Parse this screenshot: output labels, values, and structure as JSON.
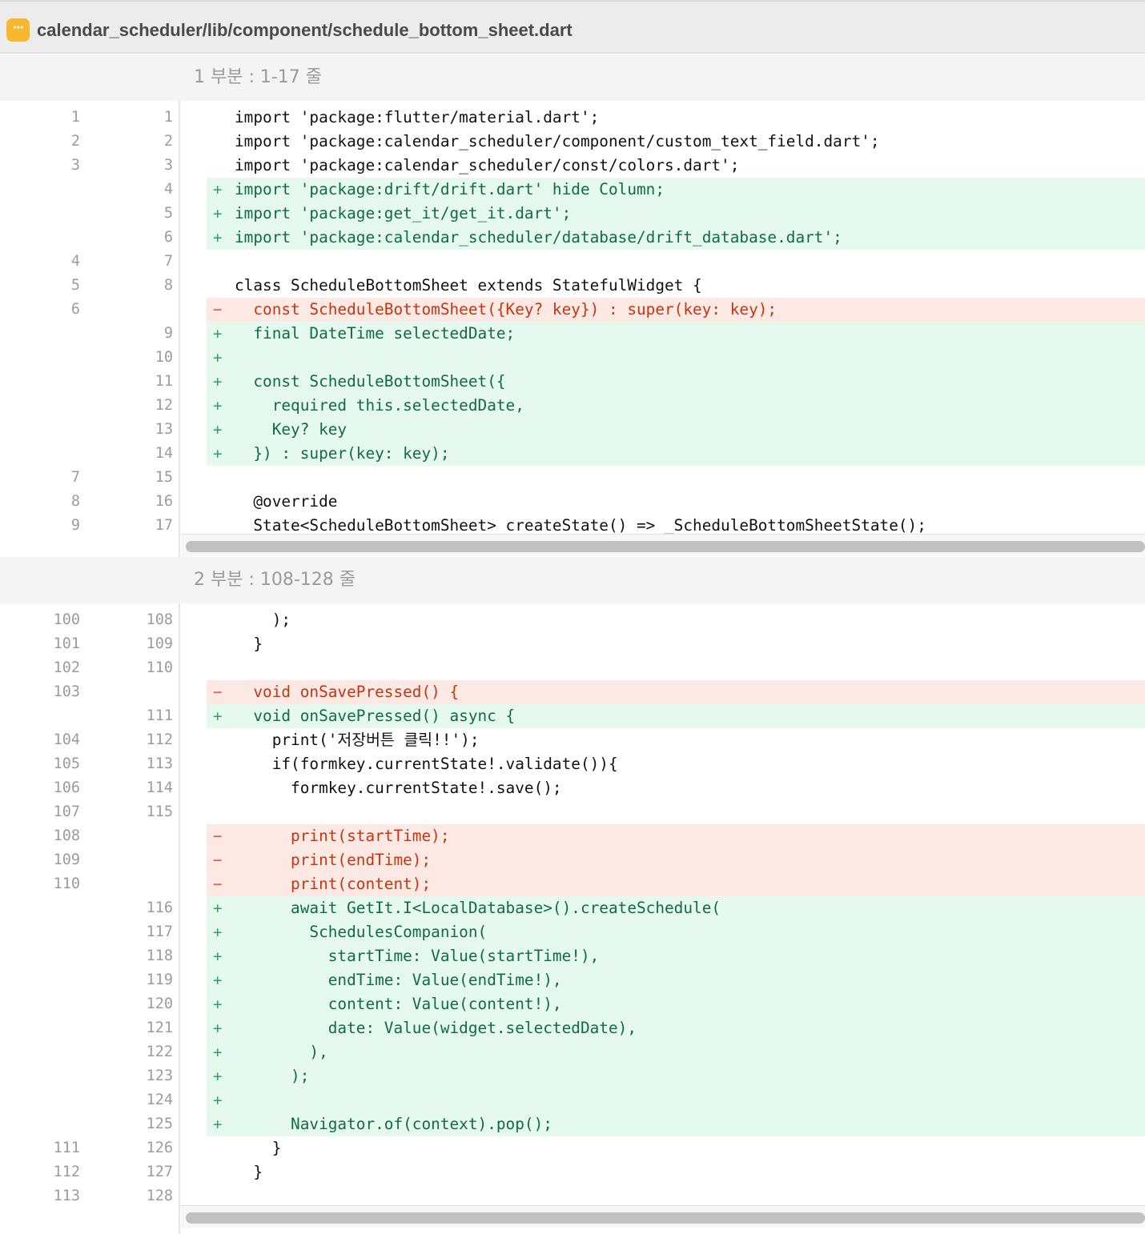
{
  "header": {
    "badge_glyph": "···",
    "file_path": "calendar_scheduler/lib/component/schedule_bottom_sheet.dart"
  },
  "hunks": [
    {
      "label": "1 부분 : 1-17 줄",
      "lines": [
        {
          "type": "ctx",
          "old": "1",
          "new": "1",
          "code": "import 'package:flutter/material.dart';"
        },
        {
          "type": "ctx",
          "old": "2",
          "new": "2",
          "code": "import 'package:calendar_scheduler/component/custom_text_field.dart';"
        },
        {
          "type": "ctx",
          "old": "3",
          "new": "3",
          "code": "import 'package:calendar_scheduler/const/colors.dart';"
        },
        {
          "type": "add",
          "old": "",
          "new": "4",
          "code": "import 'package:drift/drift.dart' hide Column;"
        },
        {
          "type": "add",
          "old": "",
          "new": "5",
          "code": "import 'package:get_it/get_it.dart';"
        },
        {
          "type": "add",
          "old": "",
          "new": "6",
          "code": "import 'package:calendar_scheduler/database/drift_database.dart';"
        },
        {
          "type": "ctx",
          "old": "4",
          "new": "7",
          "code": ""
        },
        {
          "type": "ctx",
          "old": "5",
          "new": "8",
          "code": "class ScheduleBottomSheet extends StatefulWidget {"
        },
        {
          "type": "del",
          "old": "6",
          "new": "",
          "code": "  const ScheduleBottomSheet({Key? key}) : super(key: key);"
        },
        {
          "type": "add",
          "old": "",
          "new": "9",
          "code": "  final DateTime selectedDate;"
        },
        {
          "type": "add",
          "old": "",
          "new": "10",
          "code": ""
        },
        {
          "type": "add",
          "old": "",
          "new": "11",
          "code": "  const ScheduleBottomSheet({"
        },
        {
          "type": "add",
          "old": "",
          "new": "12",
          "code": "    required this.selectedDate,"
        },
        {
          "type": "add",
          "old": "",
          "new": "13",
          "code": "    Key? key"
        },
        {
          "type": "add",
          "old": "",
          "new": "14",
          "code": "  }) : super(key: key);"
        },
        {
          "type": "ctx",
          "old": "7",
          "new": "15",
          "code": ""
        },
        {
          "type": "ctx",
          "old": "8",
          "new": "16",
          "code": "  @override"
        },
        {
          "type": "ctx",
          "old": "9",
          "new": "17",
          "code": "  State<ScheduleBottomSheet> createState() => _ScheduleBottomSheetState();"
        }
      ]
    },
    {
      "label": "2 부분 : 108-128 줄",
      "lines": [
        {
          "type": "ctx",
          "old": "100",
          "new": "108",
          "code": "    );"
        },
        {
          "type": "ctx",
          "old": "101",
          "new": "109",
          "code": "  }"
        },
        {
          "type": "ctx",
          "old": "102",
          "new": "110",
          "code": ""
        },
        {
          "type": "del",
          "old": "103",
          "new": "",
          "code": "  void onSavePressed() {"
        },
        {
          "type": "add",
          "old": "",
          "new": "111",
          "code": "  void onSavePressed() async {"
        },
        {
          "type": "ctx",
          "old": "104",
          "new": "112",
          "code": "    print('저장버튼 클릭!!');"
        },
        {
          "type": "ctx",
          "old": "105",
          "new": "113",
          "code": "    if(formkey.currentState!.validate()){"
        },
        {
          "type": "ctx",
          "old": "106",
          "new": "114",
          "code": "      formkey.currentState!.save();"
        },
        {
          "type": "ctx",
          "old": "107",
          "new": "115",
          "code": ""
        },
        {
          "type": "del",
          "old": "108",
          "new": "",
          "code": "      print(startTime);"
        },
        {
          "type": "del",
          "old": "109",
          "new": "",
          "code": "      print(endTime);"
        },
        {
          "type": "del",
          "old": "110",
          "new": "",
          "code": "      print(content);"
        },
        {
          "type": "add",
          "old": "",
          "new": "116",
          "code": "      await GetIt.I<LocalDatabase>().createSchedule("
        },
        {
          "type": "add",
          "old": "",
          "new": "117",
          "code": "        SchedulesCompanion("
        },
        {
          "type": "add",
          "old": "",
          "new": "118",
          "code": "          startTime: Value(startTime!),"
        },
        {
          "type": "add",
          "old": "",
          "new": "119",
          "code": "          endTime: Value(endTime!),"
        },
        {
          "type": "add",
          "old": "",
          "new": "120",
          "code": "          content: Value(content!),"
        },
        {
          "type": "add",
          "old": "",
          "new": "121",
          "code": "          date: Value(widget.selectedDate),"
        },
        {
          "type": "add",
          "old": "",
          "new": "122",
          "code": "        ),"
        },
        {
          "type": "add",
          "old": "",
          "new": "123",
          "code": "      );"
        },
        {
          "type": "add",
          "old": "",
          "new": "124",
          "code": ""
        },
        {
          "type": "add",
          "old": "",
          "new": "125",
          "code": "      Navigator.of(context).pop();"
        },
        {
          "type": "ctx",
          "old": "111",
          "new": "126",
          "code": "    }"
        },
        {
          "type": "ctx",
          "old": "112",
          "new": "127",
          "code": "  }"
        },
        {
          "type": "ctx",
          "old": "113",
          "new": "128",
          "code": ""
        }
      ]
    }
  ],
  "colors": {
    "added_bg": "#e5f9ee",
    "added_text": "#116b43",
    "removed_bg": "#fde9e4",
    "removed_text": "#c43512",
    "badge": "#f6b82e"
  }
}
